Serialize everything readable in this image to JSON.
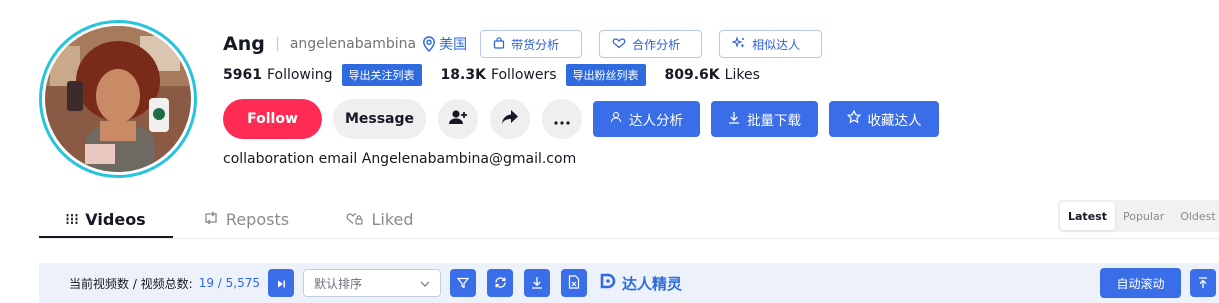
{
  "profile": {
    "nickname": "Ang",
    "username": "angelenabambina",
    "location": "美国",
    "bio": "collaboration email Angelenabambina@gmail.com"
  },
  "tag_buttons": [
    {
      "label": "带货分析",
      "icon": "bag-icon"
    },
    {
      "label": "合作分析",
      "icon": "handshake-icon"
    },
    {
      "label": "相似达人",
      "icon": "sparkle-icon"
    }
  ],
  "stats": {
    "following": {
      "value": "5961",
      "label": "Following",
      "export": "导出关注列表"
    },
    "followers": {
      "value": "18.3K",
      "label": "Followers",
      "export": "导出粉丝列表"
    },
    "likes": {
      "value": "809.6K",
      "label": "Likes"
    }
  },
  "actions": {
    "follow": "Follow",
    "message": "Message",
    "analyze": "达人分析",
    "download": "批量下载",
    "favorite": "收藏达人"
  },
  "tabs": [
    {
      "label": "Videos",
      "icon": "grid-icon"
    },
    {
      "label": "Reposts",
      "icon": "repost-icon"
    },
    {
      "label": "Liked",
      "icon": "heart-lock-icon"
    }
  ],
  "sort_options": [
    "Latest",
    "Popular",
    "Oldest"
  ],
  "toolbar": {
    "count_label": "当前视频数 / 视频总数:",
    "count_value": "19 / 5,575",
    "sort_select": "默认排序",
    "brand": "达人精灵",
    "auto_scroll": "自动滚动"
  },
  "colors": {
    "accent_blue": "#3a6ee8",
    "follow_red": "#fe2c55",
    "avatar_ring": "#27c4de"
  }
}
